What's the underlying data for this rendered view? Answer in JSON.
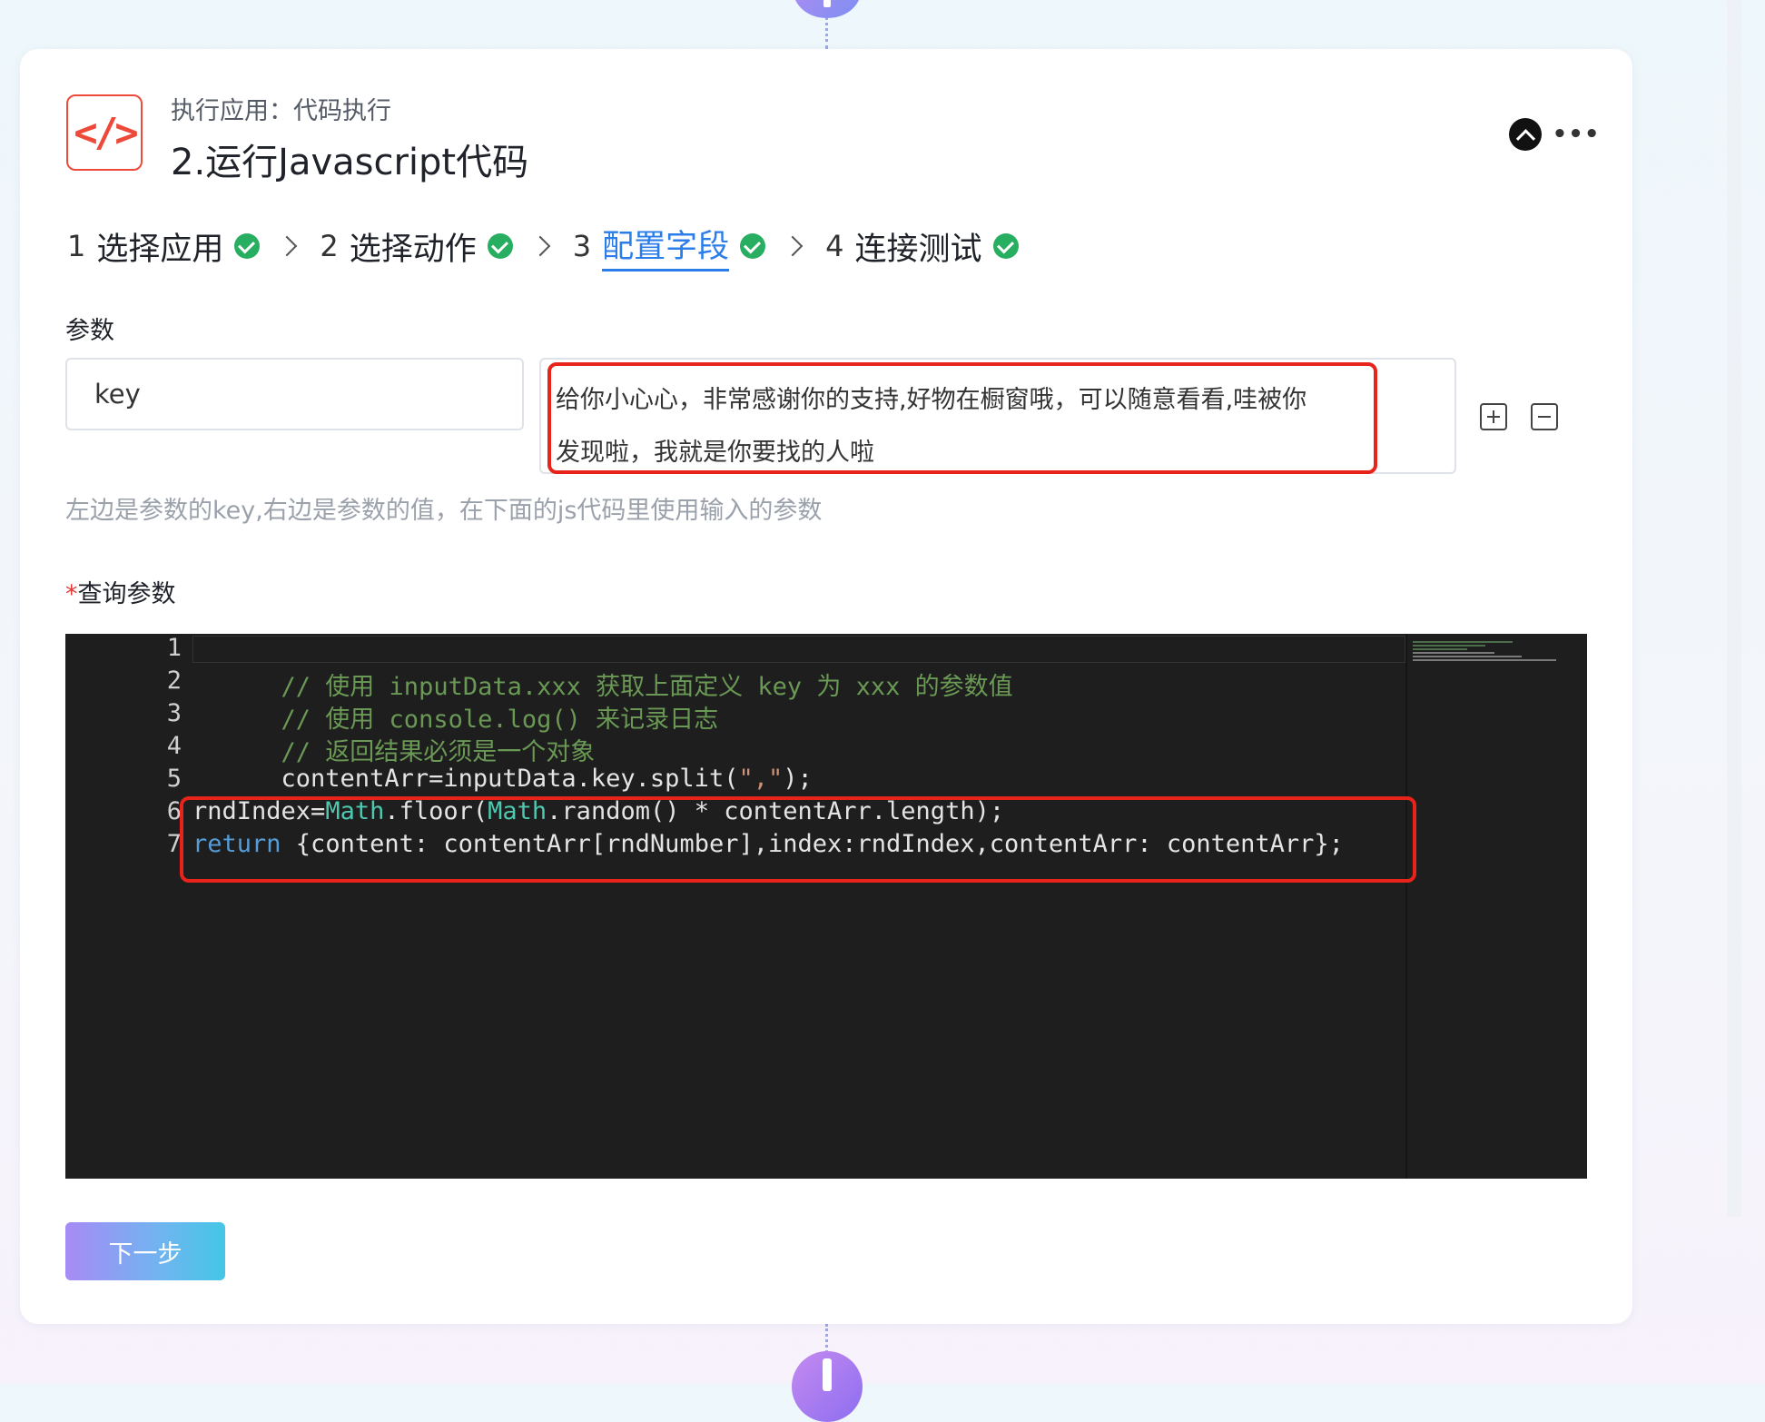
{
  "card": {
    "subtitle": "执行应用：代码执行",
    "title": "2.运行Javascript代码",
    "icon": "code-icon"
  },
  "steps": [
    {
      "num": "1",
      "label": "选择应用",
      "done": true,
      "active": false
    },
    {
      "num": "2",
      "label": "选择动作",
      "done": true,
      "active": false
    },
    {
      "num": "3",
      "label": "配置字段",
      "done": true,
      "active": true
    },
    {
      "num": "4",
      "label": "连接测试",
      "done": true,
      "active": false
    }
  ],
  "params": {
    "label": "参数",
    "key_value": "key",
    "value_line1": "给你小心心，非常感谢你的支持,好物在橱窗哦，可以随意看看,哇被你",
    "value_line2": "发现啦，我就是你要找的人啦",
    "hint": "左边是参数的key,右边是参数的值，在下面的js代码里使用输入的参数"
  },
  "query": {
    "required_mark": "*",
    "label": "查询参数"
  },
  "editor": {
    "line_numbers": [
      "1",
      "2",
      "3",
      "4",
      "5",
      "6",
      "7"
    ]
  },
  "next_button": "下一步",
  "colors": {
    "accent": "#2b7de9",
    "success": "#27ae60",
    "highlight": "#e8231a",
    "editor_bg": "#1e1e1e"
  }
}
